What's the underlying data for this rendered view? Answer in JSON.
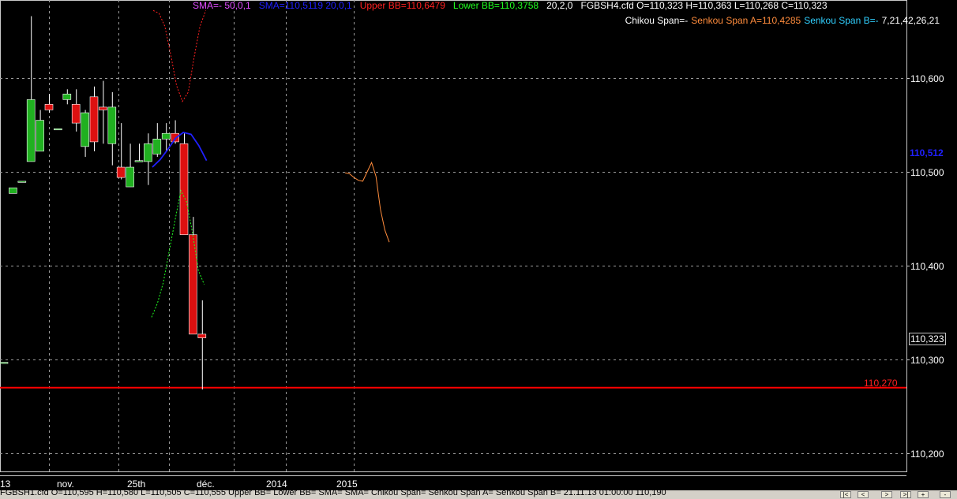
{
  "header": {
    "line1": [
      {
        "text": "SMA=-  50,0,1",
        "color": "#e04cff"
      },
      {
        "text": "SMA=110,5119  20,0,1",
        "color": "#2020ff"
      },
      {
        "text": "Upper BB=110,6479",
        "color": "#ff2020"
      },
      {
        "text": "Lower BB=110,3758",
        "color": "#20ff20"
      },
      {
        "text": "20,2,0",
        "color": "#ffffff"
      },
      {
        "text": "FGBSH4.cfd O=110,323 H=110,363 L=110,268 C=110,323",
        "color": "#ffffff"
      }
    ],
    "line2": [
      {
        "text": "Chikou Span=-",
        "color": "#ffffff"
      },
      {
        "text": "Senkou Span A=110,4285",
        "color": "#ff8c3c"
      },
      {
        "text": "Senkou Span B=-",
        "color": "#30d0ff"
      },
      {
        "text": "7,21,42,26,21",
        "color": "#ffffff"
      }
    ]
  },
  "status_bar": {
    "text": "FGBSH1.cfd O=110,595 H=110,580 L=110,505 C=110,555  Upper BB=  Lower BB=  SMA=  SMA=  Chikou Span=  Senkou Span A=  Senkou Span B=   21.11.13 01:00:00  110,190"
  },
  "chart_data": {
    "type": "candlestick",
    "instrument": "FGBSH4.cfd",
    "ylim": [
      110.18,
      110.68
    ],
    "y_ticks": [
      "110,600",
      "110,500",
      "110,400",
      "110,300",
      "110,200"
    ],
    "x_ticks": [
      "13",
      "nov.",
      "25th",
      "déc.",
      "2014",
      "2015"
    ],
    "grid": true,
    "current_price_label": "110,323",
    "current_price": 110.323,
    "sma20_label": "110,512",
    "sma20_value": 110.512,
    "support_level": 110.27,
    "support_label": "110,270",
    "colors": {
      "up": "#20b020",
      "down": "#dd1010",
      "wick": "#ffffff",
      "support": "#ff0000",
      "sma20": "#2020ff",
      "upper_bb": "#ff2020",
      "lower_bb": "#20ff20",
      "senkou_a": "#ff8c3c",
      "grid": "#9a9a9a"
    },
    "candles": [
      {
        "o": 110.297,
        "h": 110.297,
        "l": 110.297,
        "c": 110.297
      },
      {
        "o": 110.477,
        "h": 110.483,
        "l": 110.477,
        "c": 110.483
      },
      {
        "o": 110.49,
        "h": 110.49,
        "l": 110.49,
        "c": 110.49
      },
      {
        "o": 110.511,
        "h": 110.666,
        "l": 110.511,
        "c": 110.577
      },
      {
        "o": 110.522,
        "h": 110.566,
        "l": 110.522,
        "c": 110.555
      },
      {
        "o": 110.572,
        "h": 110.583,
        "l": 110.563,
        "c": 110.566
      },
      {
        "o": 110.546,
        "h": 110.546,
        "l": 110.546,
        "c": 110.546
      },
      {
        "o": 110.577,
        "h": 110.588,
        "l": 110.572,
        "c": 110.583
      },
      {
        "o": 110.572,
        "h": 110.588,
        "l": 110.543,
        "c": 110.552
      },
      {
        "o": 110.527,
        "h": 110.566,
        "l": 110.516,
        "c": 110.563
      },
      {
        "o": 110.58,
        "h": 110.591,
        "l": 110.522,
        "c": 110.532
      },
      {
        "o": 110.569,
        "h": 110.597,
        "l": 110.53,
        "c": 110.566
      },
      {
        "o": 110.53,
        "h": 110.585,
        "l": 110.507,
        "c": 110.569
      },
      {
        "o": 110.505,
        "h": 110.552,
        "l": 110.492,
        "c": 110.494
      },
      {
        "o": 110.484,
        "h": 110.53,
        "l": 110.484,
        "c": 110.505
      },
      {
        "o": 110.512,
        "h": 110.53,
        "l": 110.512,
        "c": 110.512
      },
      {
        "o": 110.511,
        "h": 110.541,
        "l": 110.486,
        "c": 110.53
      },
      {
        "o": 110.519,
        "h": 110.552,
        "l": 110.516,
        "c": 110.535
      },
      {
        "o": 110.535,
        "h": 110.552,
        "l": 110.522,
        "c": 110.541
      },
      {
        "o": 110.541,
        "h": 110.555,
        "l": 110.53,
        "c": 110.532
      },
      {
        "o": 110.53,
        "h": 110.541,
        "l": 110.497,
        "c": 110.433
      },
      {
        "o": 110.433,
        "h": 110.452,
        "l": 110.388,
        "c": 110.327
      },
      {
        "o": 110.327,
        "h": 110.363,
        "l": 110.268,
        "c": 110.323
      }
    ],
    "sma20_series": [
      110.505,
      110.513,
      110.524,
      110.536,
      110.542,
      110.54,
      110.528,
      110.512
    ],
    "upper_bb_series": [
      110.672,
      110.669,
      110.655,
      110.625,
      110.592,
      110.575,
      110.585,
      110.622,
      110.655,
      110.672
    ],
    "lower_bb_series": [
      110.345,
      110.36,
      110.382,
      110.415,
      110.448,
      110.48,
      110.468,
      110.435,
      110.395,
      110.38
    ],
    "senkou_a_series": [
      110.499,
      110.498,
      110.494,
      110.491,
      110.49,
      110.5,
      110.51,
      110.495,
      110.46,
      110.438,
      110.425
    ]
  }
}
